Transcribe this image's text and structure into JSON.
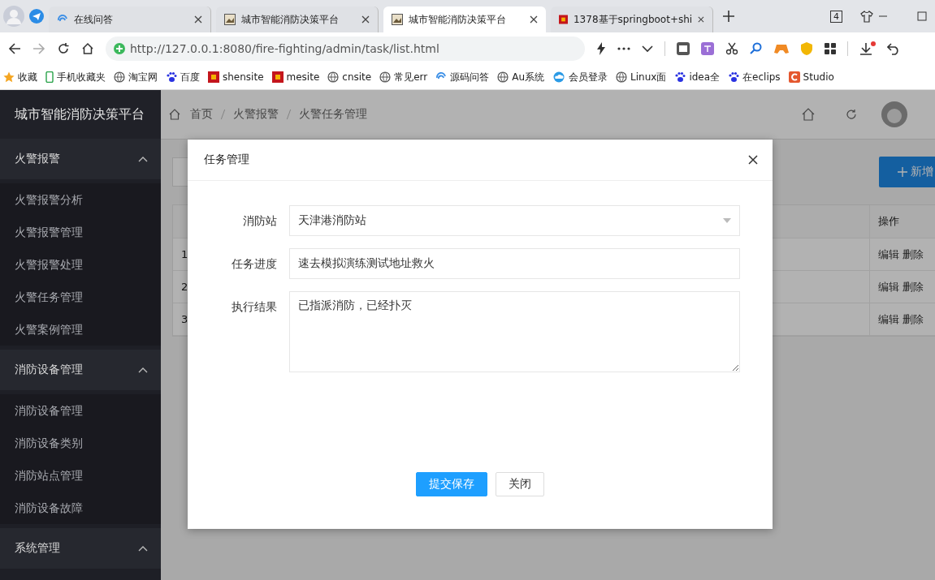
{
  "browser": {
    "tabs": [
      {
        "title": "在线问答",
        "selected": false
      },
      {
        "title": "城市智能消防决策平台",
        "selected": false
      },
      {
        "title": "城市智能消防决策平台",
        "selected": true
      },
      {
        "title": "1378基于springboot+shi",
        "selected": false
      }
    ],
    "tab_count": "4",
    "url": "http://127.0.0.1:8080/fire-fighting/admin/task/list.html",
    "bookmarks": [
      {
        "label": "收藏"
      },
      {
        "label": "手机收藏夹"
      },
      {
        "label": "淘宝网"
      },
      {
        "label": "百度"
      },
      {
        "label": "shensite"
      },
      {
        "label": "mesite"
      },
      {
        "label": "cnsite"
      },
      {
        "label": "常见err"
      },
      {
        "label": "源码问答"
      },
      {
        "label": "Au系统"
      },
      {
        "label": "会员登录"
      },
      {
        "label": "Linux面"
      },
      {
        "label": "idea全"
      },
      {
        "label": "在eclips"
      },
      {
        "label": "Studio"
      }
    ]
  },
  "app": {
    "title": "城市智能消防决策平台",
    "sidebar": [
      {
        "label": "火警报警",
        "expanded": true,
        "items": [
          {
            "label": "火警报警分析"
          },
          {
            "label": "火警报警管理"
          },
          {
            "label": "火警报警处理"
          },
          {
            "label": "火警任务管理"
          },
          {
            "label": "火警案例管理"
          }
        ]
      },
      {
        "label": "消防设备管理",
        "expanded": true,
        "items": [
          {
            "label": "消防设备管理"
          },
          {
            "label": "消防设备类别"
          },
          {
            "label": "消防站点管理"
          },
          {
            "label": "消防设备故障"
          }
        ]
      },
      {
        "label": "系统管理",
        "expanded": true
      }
    ],
    "breadcrumb": [
      "首页",
      "火警报警",
      "火警任务管理"
    ],
    "add_button": "新增",
    "table": {
      "action_header": "操作",
      "rows": [
        {
          "index": "1",
          "actions": [
            "编辑",
            "删除"
          ]
        },
        {
          "index": "2",
          "actions": [
            "编辑",
            "删除"
          ]
        },
        {
          "index": "3",
          "actions": [
            "编辑",
            "删除"
          ]
        }
      ]
    }
  },
  "dialog": {
    "title": "任务管理",
    "fields": [
      {
        "label": "消防站",
        "kind": "select",
        "value": "天津港消防站"
      },
      {
        "label": "任务进度",
        "kind": "input",
        "value": "速去模拟演练测试地址救火"
      },
      {
        "label": "执行结果",
        "kind": "textarea",
        "value": "已指派消防，已经扑灭"
      }
    ],
    "buttons": [
      {
        "label": "提交保存",
        "kind": "primary"
      },
      {
        "label": "关闭",
        "kind": "default"
      }
    ]
  }
}
